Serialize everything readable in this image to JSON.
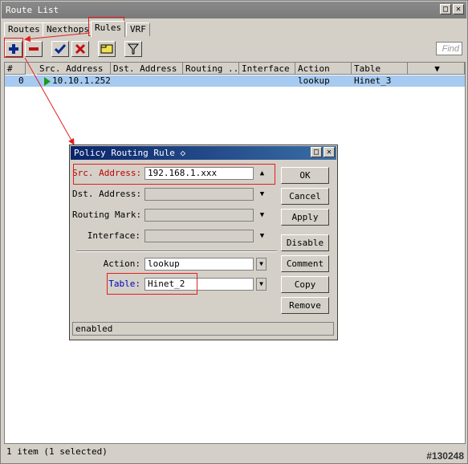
{
  "window": {
    "title": "Route List"
  },
  "tabs": [
    {
      "label": "Routes"
    },
    {
      "label": "Nexthops"
    },
    {
      "label": "Rules"
    },
    {
      "label": "VRF"
    }
  ],
  "toolbar": {
    "add_icon": "plus-icon",
    "remove_icon": "minus-icon",
    "enable_icon": "check-icon",
    "disable_icon": "x-icon",
    "comment_icon": "note-icon",
    "filter_icon": "funnel-icon",
    "find_placeholder": "Find"
  },
  "table": {
    "columns": [
      "#",
      "Src. Address",
      "Dst. Address",
      "Routing ...",
      "Interface",
      "Action",
      "Table"
    ],
    "rows": [
      {
        "num": "0",
        "src": "10.10.1.252",
        "dst": "",
        "routing": "",
        "interface": "",
        "action": "lookup",
        "table": "Hinet_3"
      }
    ]
  },
  "status": {
    "text": "1 item (1 selected)"
  },
  "watermark": "#130248",
  "dialog": {
    "title": "Policy Routing Rule ◇",
    "src_label": "Src. Address:",
    "src_value": "192.168.1.xxx",
    "dst_label": "Dst. Address:",
    "routing_mark_label": "Routing Mark:",
    "interface_label": "Interface:",
    "action_label": "Action:",
    "action_value": "lookup",
    "table_label": "Table:",
    "table_value": "Hinet_2",
    "buttons": {
      "ok": "OK",
      "cancel": "Cancel",
      "apply": "Apply",
      "disable": "Disable",
      "comment": "Comment",
      "copy": "Copy",
      "remove": "Remove"
    },
    "status": "enabled"
  },
  "colors": {
    "annotation_red": "#e02020",
    "selected_row": "#a6caf0",
    "dialog_title": "#0a246a",
    "highlight_label_red": "#c00000",
    "highlight_label_blue": "#0000c0"
  }
}
